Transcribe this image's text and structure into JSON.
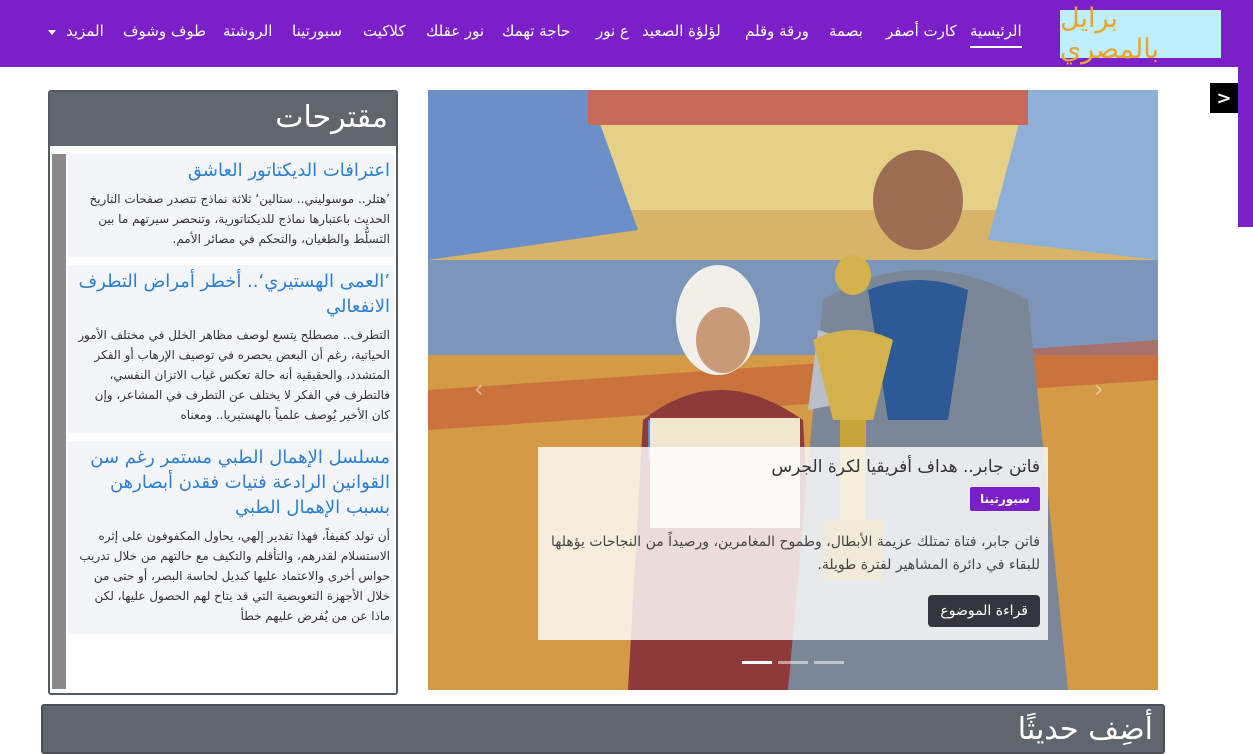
{
  "logo": {
    "text": "برايل بالمصري"
  },
  "nav": {
    "items": [
      "الرئيسية",
      "كارت أصفر",
      "بصمة",
      "ورقة وقلم",
      "لؤلؤة الصعيد",
      "ع نور",
      "حاجة تهمك",
      "نور عقلك",
      "كلاكيت",
      "سبورتينا",
      "الروشتة",
      "طوف وشوف",
      "المزيد"
    ],
    "active_index": 0
  },
  "side_toggle": {
    "label": ">"
  },
  "suggestions": {
    "title": "مقترحات",
    "items": [
      {
        "title": "اعترافات الديكتاتور العاشق",
        "excerpt": "’هتلر.. موسوليني.. ستالين‘ ثلاثة نماذج تتصدر صفحات التاريخ الحديث باعتبارها نماذج للديكتاتورية، وتنحصر سيرتهم ما بين التسلُّط والطغيان، والتحكم في مصائر الأمم."
      },
      {
        "title": "’العمى الهستيري‘.. أخطر أمراض التطرف الانفعالي",
        "excerpt": "التطرف.. مصطلح يتسع لوصف مظاهر الخلل في مختلف الأمور الحياتية، رغم أن البعض يحصره في توصيف الإرهاب أو الفكر المتشدد، والحقيقية أنه حالة تعكس غياب الاتزان النفسي، فالتطرف في الفكر لا يختلف عن التطرف في المشاعر، وإن كان الأخير يُوصف علمياً بالهستيريا.. ومعناه"
      },
      {
        "title": "مسلسل الإهمال الطبي مستمر رغم سن القوانين الرادعة فتيات فقدن أبصارهن بسبب الإهمال الطبي",
        "excerpt": "أن تولد كفيفاً، فهذا تقدير إلهي، يحاول المكفوفون على إثره الاستسلام لقدرهم، والتأقلم والتكيف مع حالتهم من خلال تدريب حواس أخرى والاعتماد عليها كبديل لحاسة البصر، أو حتى من خلال الأجهزة التعويضية التي قد يتاح لهم الحصول عليها، لكن ماذا عن من يُفرض عليهم خطأ"
      }
    ]
  },
  "slide": {
    "title": "فاتن جابر.. هداف أفريقيا لكرة الجرس",
    "category": "سبورتينا",
    "excerpt": "فاتن جابر، فتاة تمتلك عزيمة الأبطال، وطموح المغامرين، ورصيداً من النجاحات يؤهلها للبقاء في دائرة المشاهير لفترة طويلة.",
    "read_more": "قراءة الموضوع",
    "indicator_count": 3,
    "active_indicator": 0
  },
  "add_topic": {
    "title": "أضِف حديثًا"
  },
  "colors": {
    "brand": "#7b1fc9",
    "header_gray": "#60656e",
    "link_blue": "#2b7fd0",
    "logo_orange": "#e8a431"
  }
}
